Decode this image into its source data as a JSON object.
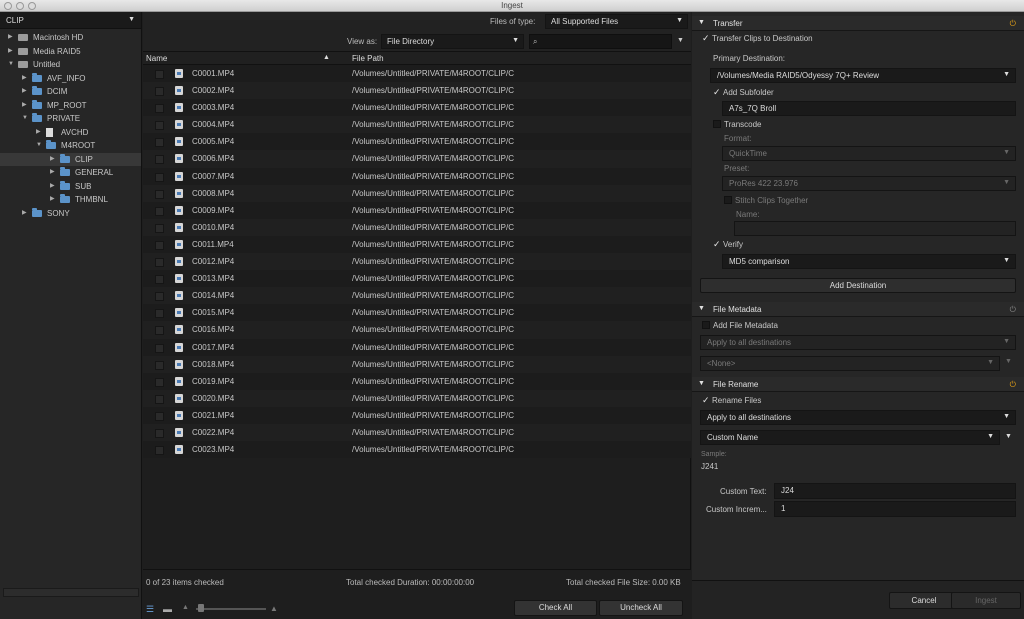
{
  "window": {
    "title": "Ingest"
  },
  "source": {
    "selected": "CLIP",
    "tree": [
      {
        "label": "Macintosh HD",
        "type": "drive",
        "indent": 0
      },
      {
        "label": "Media RAID5",
        "type": "drive",
        "indent": 0
      },
      {
        "label": "Untitled",
        "type": "drive",
        "indent": 0,
        "open": true
      },
      {
        "label": "AVF_INFO",
        "type": "folder",
        "indent": 1
      },
      {
        "label": "DCIM",
        "type": "folder",
        "indent": 1
      },
      {
        "label": "MP_ROOT",
        "type": "folder",
        "indent": 1
      },
      {
        "label": "PRIVATE",
        "type": "folder",
        "indent": 1,
        "open": true
      },
      {
        "label": "AVCHD",
        "type": "doc",
        "indent": 2
      },
      {
        "label": "M4ROOT",
        "type": "folder",
        "indent": 2,
        "open": true
      },
      {
        "label": "CLIP",
        "type": "folder",
        "indent": 3,
        "selected": true
      },
      {
        "label": "GENERAL",
        "type": "folder",
        "indent": 3
      },
      {
        "label": "SUB",
        "type": "folder",
        "indent": 3
      },
      {
        "label": "THMBNL",
        "type": "folder",
        "indent": 3
      },
      {
        "label": "SONY",
        "type": "folder",
        "indent": 1
      }
    ]
  },
  "browser": {
    "files_of_type_label": "Files of type:",
    "files_of_type_value": "All Supported Files",
    "view_as_label": "View as:",
    "view_as_value": "File Directory",
    "columns": {
      "name": "Name",
      "path": "File Path"
    },
    "files": [
      {
        "name": "C0001.MP4",
        "path": "/Volumes/Untitled/PRIVATE/M4ROOT/CLIP/C"
      },
      {
        "name": "C0002.MP4",
        "path": "/Volumes/Untitled/PRIVATE/M4ROOT/CLIP/C"
      },
      {
        "name": "C0003.MP4",
        "path": "/Volumes/Untitled/PRIVATE/M4ROOT/CLIP/C"
      },
      {
        "name": "C0004.MP4",
        "path": "/Volumes/Untitled/PRIVATE/M4ROOT/CLIP/C"
      },
      {
        "name": "C0005.MP4",
        "path": "/Volumes/Untitled/PRIVATE/M4ROOT/CLIP/C"
      },
      {
        "name": "C0006.MP4",
        "path": "/Volumes/Untitled/PRIVATE/M4ROOT/CLIP/C"
      },
      {
        "name": "C0007.MP4",
        "path": "/Volumes/Untitled/PRIVATE/M4ROOT/CLIP/C"
      },
      {
        "name": "C0008.MP4",
        "path": "/Volumes/Untitled/PRIVATE/M4ROOT/CLIP/C"
      },
      {
        "name": "C0009.MP4",
        "path": "/Volumes/Untitled/PRIVATE/M4ROOT/CLIP/C"
      },
      {
        "name": "C0010.MP4",
        "path": "/Volumes/Untitled/PRIVATE/M4ROOT/CLIP/C"
      },
      {
        "name": "C0011.MP4",
        "path": "/Volumes/Untitled/PRIVATE/M4ROOT/CLIP/C"
      },
      {
        "name": "C0012.MP4",
        "path": "/Volumes/Untitled/PRIVATE/M4ROOT/CLIP/C"
      },
      {
        "name": "C0013.MP4",
        "path": "/Volumes/Untitled/PRIVATE/M4ROOT/CLIP/C"
      },
      {
        "name": "C0014.MP4",
        "path": "/Volumes/Untitled/PRIVATE/M4ROOT/CLIP/C"
      },
      {
        "name": "C0015.MP4",
        "path": "/Volumes/Untitled/PRIVATE/M4ROOT/CLIP/C"
      },
      {
        "name": "C0016.MP4",
        "path": "/Volumes/Untitled/PRIVATE/M4ROOT/CLIP/C"
      },
      {
        "name": "C0017.MP4",
        "path": "/Volumes/Untitled/PRIVATE/M4ROOT/CLIP/C"
      },
      {
        "name": "C0018.MP4",
        "path": "/Volumes/Untitled/PRIVATE/M4ROOT/CLIP/C"
      },
      {
        "name": "C0019.MP4",
        "path": "/Volumes/Untitled/PRIVATE/M4ROOT/CLIP/C"
      },
      {
        "name": "C0020.MP4",
        "path": "/Volumes/Untitled/PRIVATE/M4ROOT/CLIP/C"
      },
      {
        "name": "C0021.MP4",
        "path": "/Volumes/Untitled/PRIVATE/M4ROOT/CLIP/C"
      },
      {
        "name": "C0022.MP4",
        "path": "/Volumes/Untitled/PRIVATE/M4ROOT/CLIP/C"
      },
      {
        "name": "C0023.MP4",
        "path": "/Volumes/Untitled/PRIVATE/M4ROOT/CLIP/C"
      }
    ],
    "status": {
      "checked": "0 of 23 items checked",
      "duration": "Total checked Duration: 00:00:00:00",
      "size": "Total checked File Size: 0.00 KB"
    },
    "check_all": "Check All",
    "uncheck_all": "Uncheck All"
  },
  "transfer": {
    "title": "Transfer",
    "transfer_clips": "Transfer Clips to Destination",
    "primary_destination_label": "Primary Destination:",
    "primary_destination": "/Volumes/Media RAID5/Odyessy 7Q+ Review",
    "add_subfolder": "Add Subfolder",
    "subfolder_name": "A7s_7Q Broll",
    "transcode": "Transcode",
    "format_label": "Format:",
    "format_value": "QuickTime",
    "preset_label": "Preset:",
    "preset_value": "ProRes 422 23.976",
    "stitch": "Stitch Clips Together",
    "name_label": "Name:",
    "verify": "Verify",
    "verify_method": "MD5 comparison",
    "add_destination": "Add Destination"
  },
  "metadata": {
    "title": "File Metadata",
    "add_file_metadata": "Add File Metadata",
    "apply_to": "Apply to all destinations",
    "preset": "<None>"
  },
  "rename": {
    "title": "File Rename",
    "rename_files": "Rename Files",
    "apply_to": "Apply to all destinations",
    "mode": "Custom Name",
    "sample_label": "Sample:",
    "sample_value": "J241",
    "custom_text_label": "Custom Text:",
    "custom_text_value": "J24",
    "custom_increment_label": "Custom Increm...",
    "custom_increment_value": "1"
  },
  "footer": {
    "cancel": "Cancel",
    "ingest": "Ingest"
  },
  "colors": {
    "accent_power": "#e8a317",
    "folder": "#5b93c9"
  }
}
